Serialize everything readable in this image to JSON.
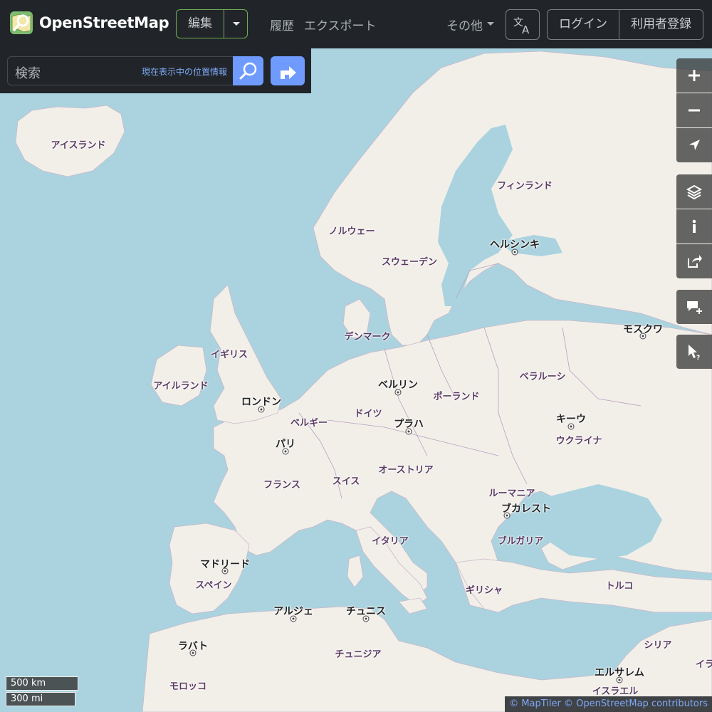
{
  "header": {
    "brand": "OpenStreetMap",
    "edit_label": "編集",
    "history_label": "履歴",
    "export_label": "エクスポート",
    "more_label": "その他",
    "login_label": "ログイン",
    "signup_label": "利用者登録"
  },
  "search": {
    "placeholder": "検索",
    "where_link": "現在表示中の位置情報"
  },
  "map": {
    "labels": [
      {
        "text": "アイスランド",
        "kind": "country"
      },
      {
        "text": "フィンランド",
        "kind": "country"
      },
      {
        "text": "ヘルシンキ",
        "kind": "city"
      },
      {
        "text": "ノルウェー",
        "kind": "country"
      },
      {
        "text": "スウェーデン",
        "kind": "country"
      },
      {
        "text": "モスクワ",
        "kind": "city"
      },
      {
        "text": "デンマーク",
        "kind": "country"
      },
      {
        "text": "イギリス",
        "kind": "country"
      },
      {
        "text": "ベラルーシ",
        "kind": "country"
      },
      {
        "text": "アイルランド",
        "kind": "country"
      },
      {
        "text": "ベルリン",
        "kind": "city"
      },
      {
        "text": "ポーランド",
        "kind": "country"
      },
      {
        "text": "ロンドン",
        "kind": "city"
      },
      {
        "text": "ドイツ",
        "kind": "country"
      },
      {
        "text": "ベルギー",
        "kind": "country"
      },
      {
        "text": "キーウ",
        "kind": "city"
      },
      {
        "text": "プラハ",
        "kind": "city"
      },
      {
        "text": "ウクライナ",
        "kind": "country"
      },
      {
        "text": "パリ",
        "kind": "city"
      },
      {
        "text": "オーストリア",
        "kind": "country"
      },
      {
        "text": "スイス",
        "kind": "country"
      },
      {
        "text": "フランス",
        "kind": "country"
      },
      {
        "text": "ルーマニア",
        "kind": "country"
      },
      {
        "text": "ブカレスト",
        "kind": "city"
      },
      {
        "text": "イタリア",
        "kind": "country"
      },
      {
        "text": "ブルガリア",
        "kind": "country"
      },
      {
        "text": "マドリード",
        "kind": "city"
      },
      {
        "text": "スペイン",
        "kind": "country"
      },
      {
        "text": "ギリシャ",
        "kind": "country"
      },
      {
        "text": "トルコ",
        "kind": "country"
      },
      {
        "text": "アルジェ",
        "kind": "city"
      },
      {
        "text": "チュニス",
        "kind": "city"
      },
      {
        "text": "ラバト",
        "kind": "city"
      },
      {
        "text": "チュニジア",
        "kind": "country"
      },
      {
        "text": "シリア",
        "kind": "country"
      },
      {
        "text": "エルサレム",
        "kind": "city"
      },
      {
        "text": "イスラエル",
        "kind": "country"
      },
      {
        "text": "モロッコ",
        "kind": "country"
      },
      {
        "text": "イラ",
        "kind": "country"
      }
    ],
    "scale_km": "500 km",
    "scale_mi": "300 mi",
    "attribution_maptiler": "© MapTiler",
    "attribution_osm": "© OpenStreetMap contributors"
  },
  "controls": [
    "zoom-in-icon",
    "zoom-out-icon",
    "locate-icon",
    "layers-icon",
    "info-icon",
    "share-icon",
    "add-note-icon",
    "query-icon"
  ],
  "colors": {
    "sea": "#aad3df",
    "land": "#f2efe9",
    "header": "#212529",
    "accent": "#6f9bff",
    "edit_border": "#6fae53"
  }
}
